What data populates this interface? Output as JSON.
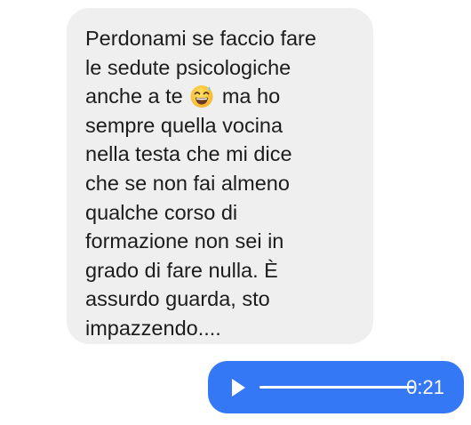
{
  "conversation": {
    "incoming_message": {
      "lines": [
        "Perdonami se faccio fare",
        "le sedute psicologiche",
        "anche a te",
        "ma ho",
        "sempre quella vocina",
        "nella testa che mi dice",
        "che se non fai almeno",
        "qualche corso di",
        "formazione non sei in",
        "grado di fare nulla. È",
        "assurdo guarda, sto",
        "impazzendo...."
      ],
      "emoji": "grinning-face-with-sweat-icon"
    },
    "outgoing_audio": {
      "duration": "0:21",
      "play_icon": "play-icon",
      "progress": 0
    }
  },
  "colors": {
    "incoming_bubble": "#efefef",
    "incoming_text": "#1c1c1c",
    "outgoing_bubble": "#3478f6",
    "outgoing_foreground": "#ffffff"
  }
}
